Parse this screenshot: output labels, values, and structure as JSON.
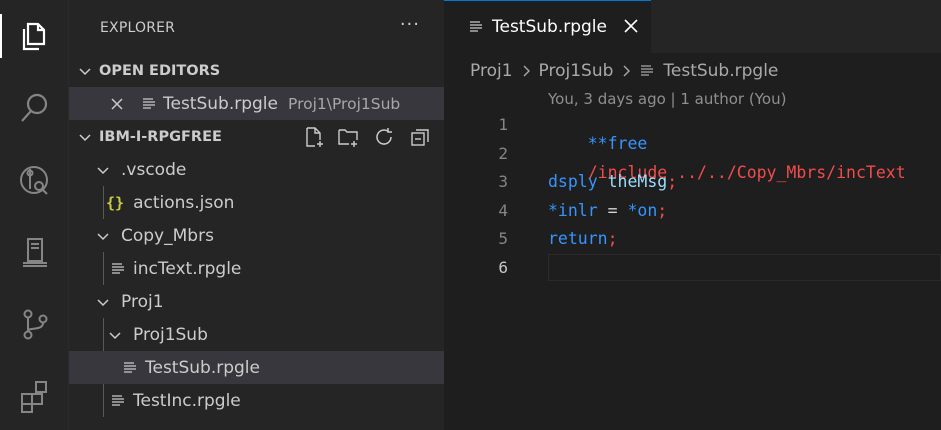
{
  "activity_bar": {
    "items": [
      {
        "icon": "files-icon",
        "active": true
      },
      {
        "icon": "search-icon",
        "active": false
      },
      {
        "icon": "source-search-icon",
        "active": false
      },
      {
        "icon": "server-icon",
        "active": false
      },
      {
        "icon": "source-control-icon",
        "active": false
      },
      {
        "icon": "extensions-icon",
        "active": false
      }
    ]
  },
  "sidebar": {
    "title": "EXPLORER",
    "more": "···",
    "open_editors": {
      "label": "OPEN EDITORS",
      "items": [
        {
          "name": "TestSub.rpgle",
          "description": "Proj1\\Proj1Sub"
        }
      ]
    },
    "workspace": {
      "label": "IBM-I-RPGFREE",
      "toolbar": [
        "new-file-icon",
        "new-folder-icon",
        "refresh-icon",
        "collapse-all-icon"
      ],
      "tree": [
        {
          "label": ".vscode",
          "type": "folder"
        },
        {
          "label": "actions.json",
          "type": "json"
        },
        {
          "label": "Copy_Mbrs",
          "type": "folder"
        },
        {
          "label": "incText.rpgle",
          "type": "file"
        },
        {
          "label": "Proj1",
          "type": "folder"
        },
        {
          "label": "Proj1Sub",
          "type": "folder"
        },
        {
          "label": "TestSub.rpgle",
          "type": "file",
          "selected": true
        },
        {
          "label": "TestInc.rpgle",
          "type": "file"
        }
      ]
    }
  },
  "editor": {
    "tab": {
      "label": "TestSub.rpgle"
    },
    "breadcrumb": [
      "Proj1",
      "Proj1Sub",
      "TestSub.rpgle"
    ],
    "codelens": "You, 3 days ago | 1 author (You)",
    "line_numbers": [
      "1",
      "2",
      "3",
      "4",
      "5",
      "6"
    ],
    "current_line": 6,
    "code": [
      {
        "parts": [
          "**free"
        ]
      },
      {
        "parts": [
          "/include ../../Copy_Mbrs/incText"
        ]
      },
      {
        "parts": [
          "dsply",
          " ",
          "theMsg",
          ";"
        ]
      },
      {
        "parts": [
          "*inlr",
          " = ",
          "*on",
          ";"
        ]
      },
      {
        "parts": [
          "return",
          ";"
        ]
      },
      {
        "parts": []
      }
    ],
    "colors": {
      "directive": "#3794ff",
      "include": "#f14c4c",
      "keyword": "#3794ff",
      "variable": "#9cdcfe",
      "semicolon": "#f14c4c",
      "plain": "#d4d4d4"
    }
  }
}
